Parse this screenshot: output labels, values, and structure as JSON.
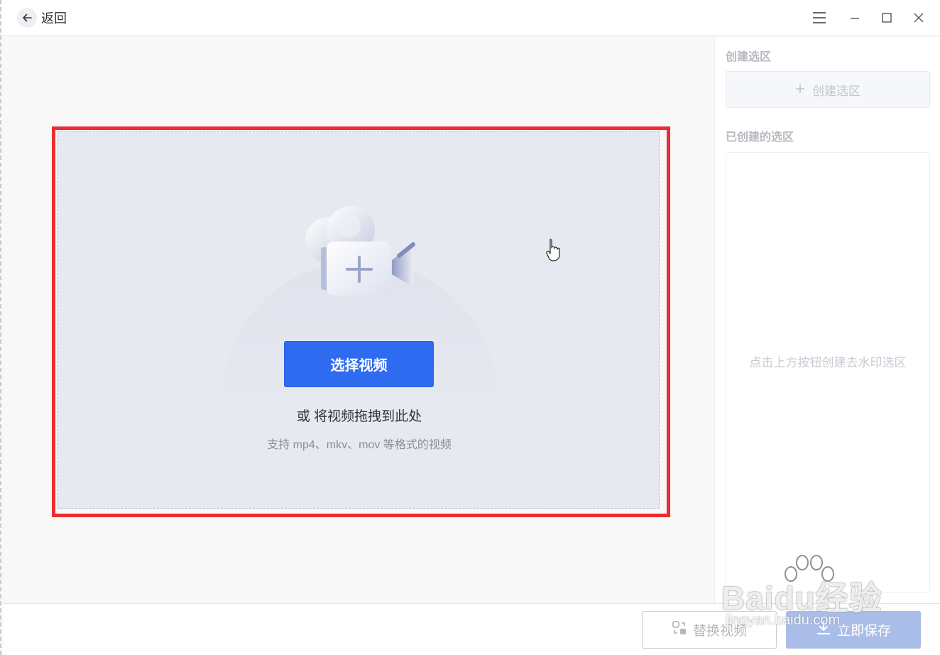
{
  "titlebar": {
    "back_label": "返回"
  },
  "main": {
    "select_button": "选择视频",
    "drag_hint": "或 将视频拖拽到此处",
    "format_hint": "支持 mp4、mkv、mov 等格式的视频"
  },
  "side": {
    "create_section_title": "创建选区",
    "create_button_label": "创建选区",
    "created_section_title": "已创建的选区",
    "empty_hint": "点击上方按钮创建去水印选区"
  },
  "footer": {
    "replace_label": "替换视频",
    "save_label": "立即保存"
  },
  "watermark": {
    "brand": "Baidu经验",
    "url": "jingyan.baidu.com"
  },
  "colors": {
    "accent": "#2f6bf1",
    "highlight_border": "#ee2b2f",
    "dropzone_bg": "#e7e9f1"
  }
}
